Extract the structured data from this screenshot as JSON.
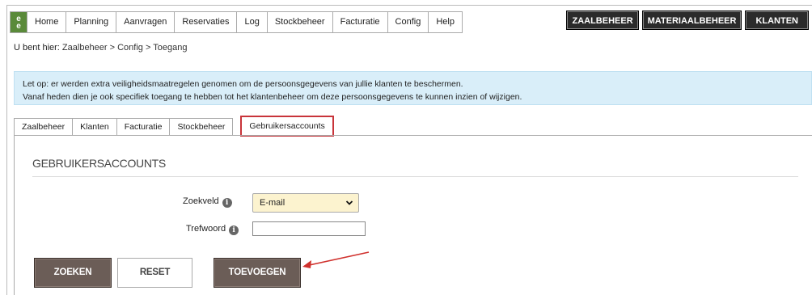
{
  "logo": {
    "letters": [
      "e",
      "e"
    ]
  },
  "nav": {
    "items": [
      "Home",
      "Planning",
      "Aanvragen",
      "Reservaties",
      "Log",
      "Stockbeheer",
      "Facturatie",
      "Config",
      "Help"
    ]
  },
  "modules": {
    "zaalbeheer": "ZAALBEHEER",
    "materiaalbeheer": "MATERIAALBEHEER",
    "klanten": "KLANTEN"
  },
  "breadcrumb": {
    "prefix": "U bent hier: ",
    "path": "Zaalbeheer > Config > Toegang"
  },
  "notice": {
    "line1": "Let op: er werden extra veiligheidsmaatregelen genomen om de persoonsgegevens van jullie klanten te beschermen.",
    "line2": "Vanaf heden dien je ook specifiek toegang te hebben tot het klantenbeheer om deze persoonsgegevens te kunnen inzien of wijzigen."
  },
  "tabs": [
    "Zaalbeheer",
    "Klanten",
    "Facturatie",
    "Stockbeheer",
    "Gebruikersaccounts"
  ],
  "section": {
    "title": "GEBRUIKERSACCOUNTS"
  },
  "form": {
    "zoekveld_label": "Zoekveld",
    "zoekveld_value": "E-mail",
    "trefwoord_label": "Trefwoord",
    "trefwoord_value": "",
    "info_glyph": "i"
  },
  "buttons": {
    "zoeken": "ZOEKEN",
    "reset": "RESET",
    "toevoegen": "TOEVOEGEN"
  },
  "colors": {
    "highlight": "#c8343a",
    "button_dark": "#6b5d57",
    "notice_bg": "#d9eef9",
    "select_bg": "#fcf3cf"
  }
}
